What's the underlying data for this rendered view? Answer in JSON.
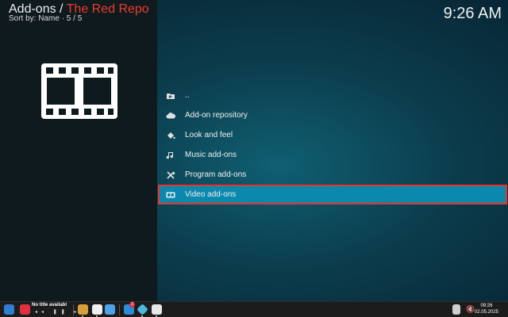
{
  "header": {
    "section": "Add-ons",
    "separator": " / ",
    "repo": "The Red Repo",
    "sort_text": "Sort by: Name  ·  5 / 5"
  },
  "clock": "9:26 AM",
  "poster_icon": "film-strip-icon",
  "list": {
    "items": [
      {
        "label": "..",
        "icon": "folder-back-icon",
        "selected": false
      },
      {
        "label": "Add-on repository",
        "icon": "cloud-icon",
        "selected": false
      },
      {
        "label": "Look and feel",
        "icon": "paint-bucket-icon",
        "selected": false
      },
      {
        "label": "Music add-ons",
        "icon": "music-note-icon",
        "selected": false
      },
      {
        "label": "Program add-ons",
        "icon": "tools-icon",
        "selected": false
      },
      {
        "label": "Video add-ons",
        "icon": "film-icon",
        "selected": true
      }
    ]
  },
  "taskbar": {
    "media_title": "No title availabl",
    "badge_count": "2",
    "time": "09:26",
    "date": "02.05.2025"
  },
  "colors": {
    "accent_red": "#ef3b2c",
    "selected_bg": "#0b88ad",
    "selected_border": "#e8352a"
  }
}
